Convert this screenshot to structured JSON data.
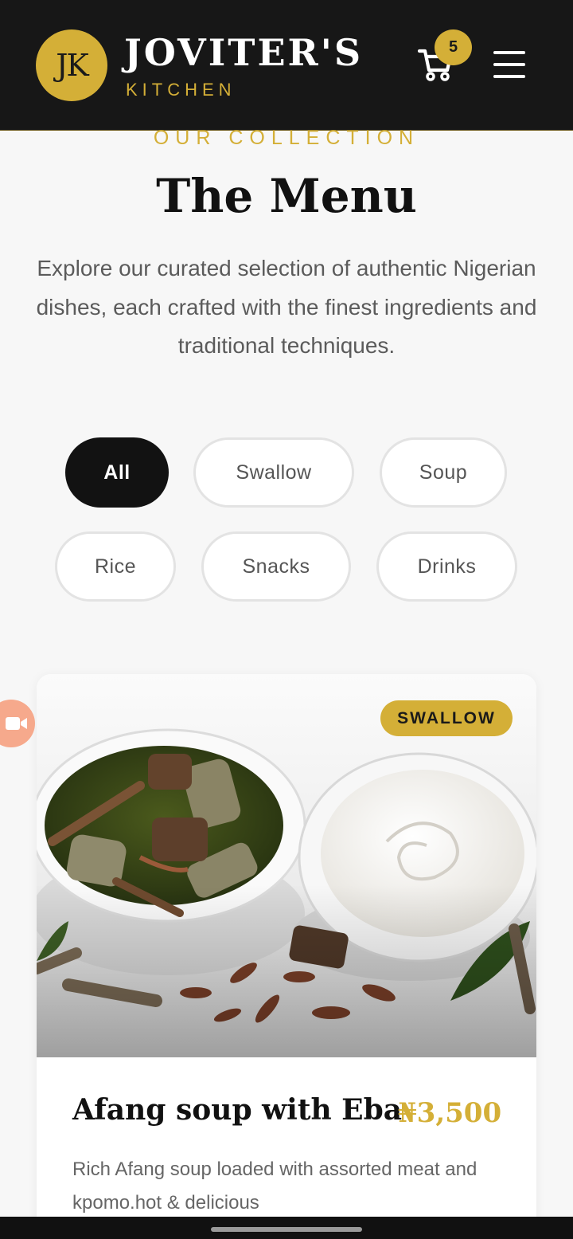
{
  "header": {
    "logo_initials": "JK",
    "brand_name": "JOVITER'S",
    "brand_sub": "KITCHEN",
    "cart_icon": "cart-icon",
    "cart_count": "5",
    "menu_icon": "hamburger-menu-icon"
  },
  "intro": {
    "eyebrow": "OUR COLLECTION",
    "title": "The Menu",
    "description": "Explore our curated selection of authentic Nigerian dishes, each crafted with the finest ingredients and traditional techniques."
  },
  "filters": [
    {
      "label": "All",
      "active": true
    },
    {
      "label": "Swallow",
      "active": false
    },
    {
      "label": "Soup",
      "active": false
    },
    {
      "label": "Rice",
      "active": false
    },
    {
      "label": "Snacks",
      "active": false
    },
    {
      "label": "Drinks",
      "active": false
    }
  ],
  "menu_items": [
    {
      "category": "SWALLOW",
      "name": "Afang soup with Eba",
      "price": "₦3,500",
      "description": "Rich Afang soup loaded with assorted meat and kpomo.hot & delicious"
    }
  ],
  "floating": {
    "icon": "video-camera-icon"
  },
  "colors": {
    "header_bg": "#171717",
    "accent_gold": "#d4af37",
    "page_bg": "#f7f7f7",
    "pill_active_bg": "#121212",
    "video_button": "#f6a98c"
  }
}
